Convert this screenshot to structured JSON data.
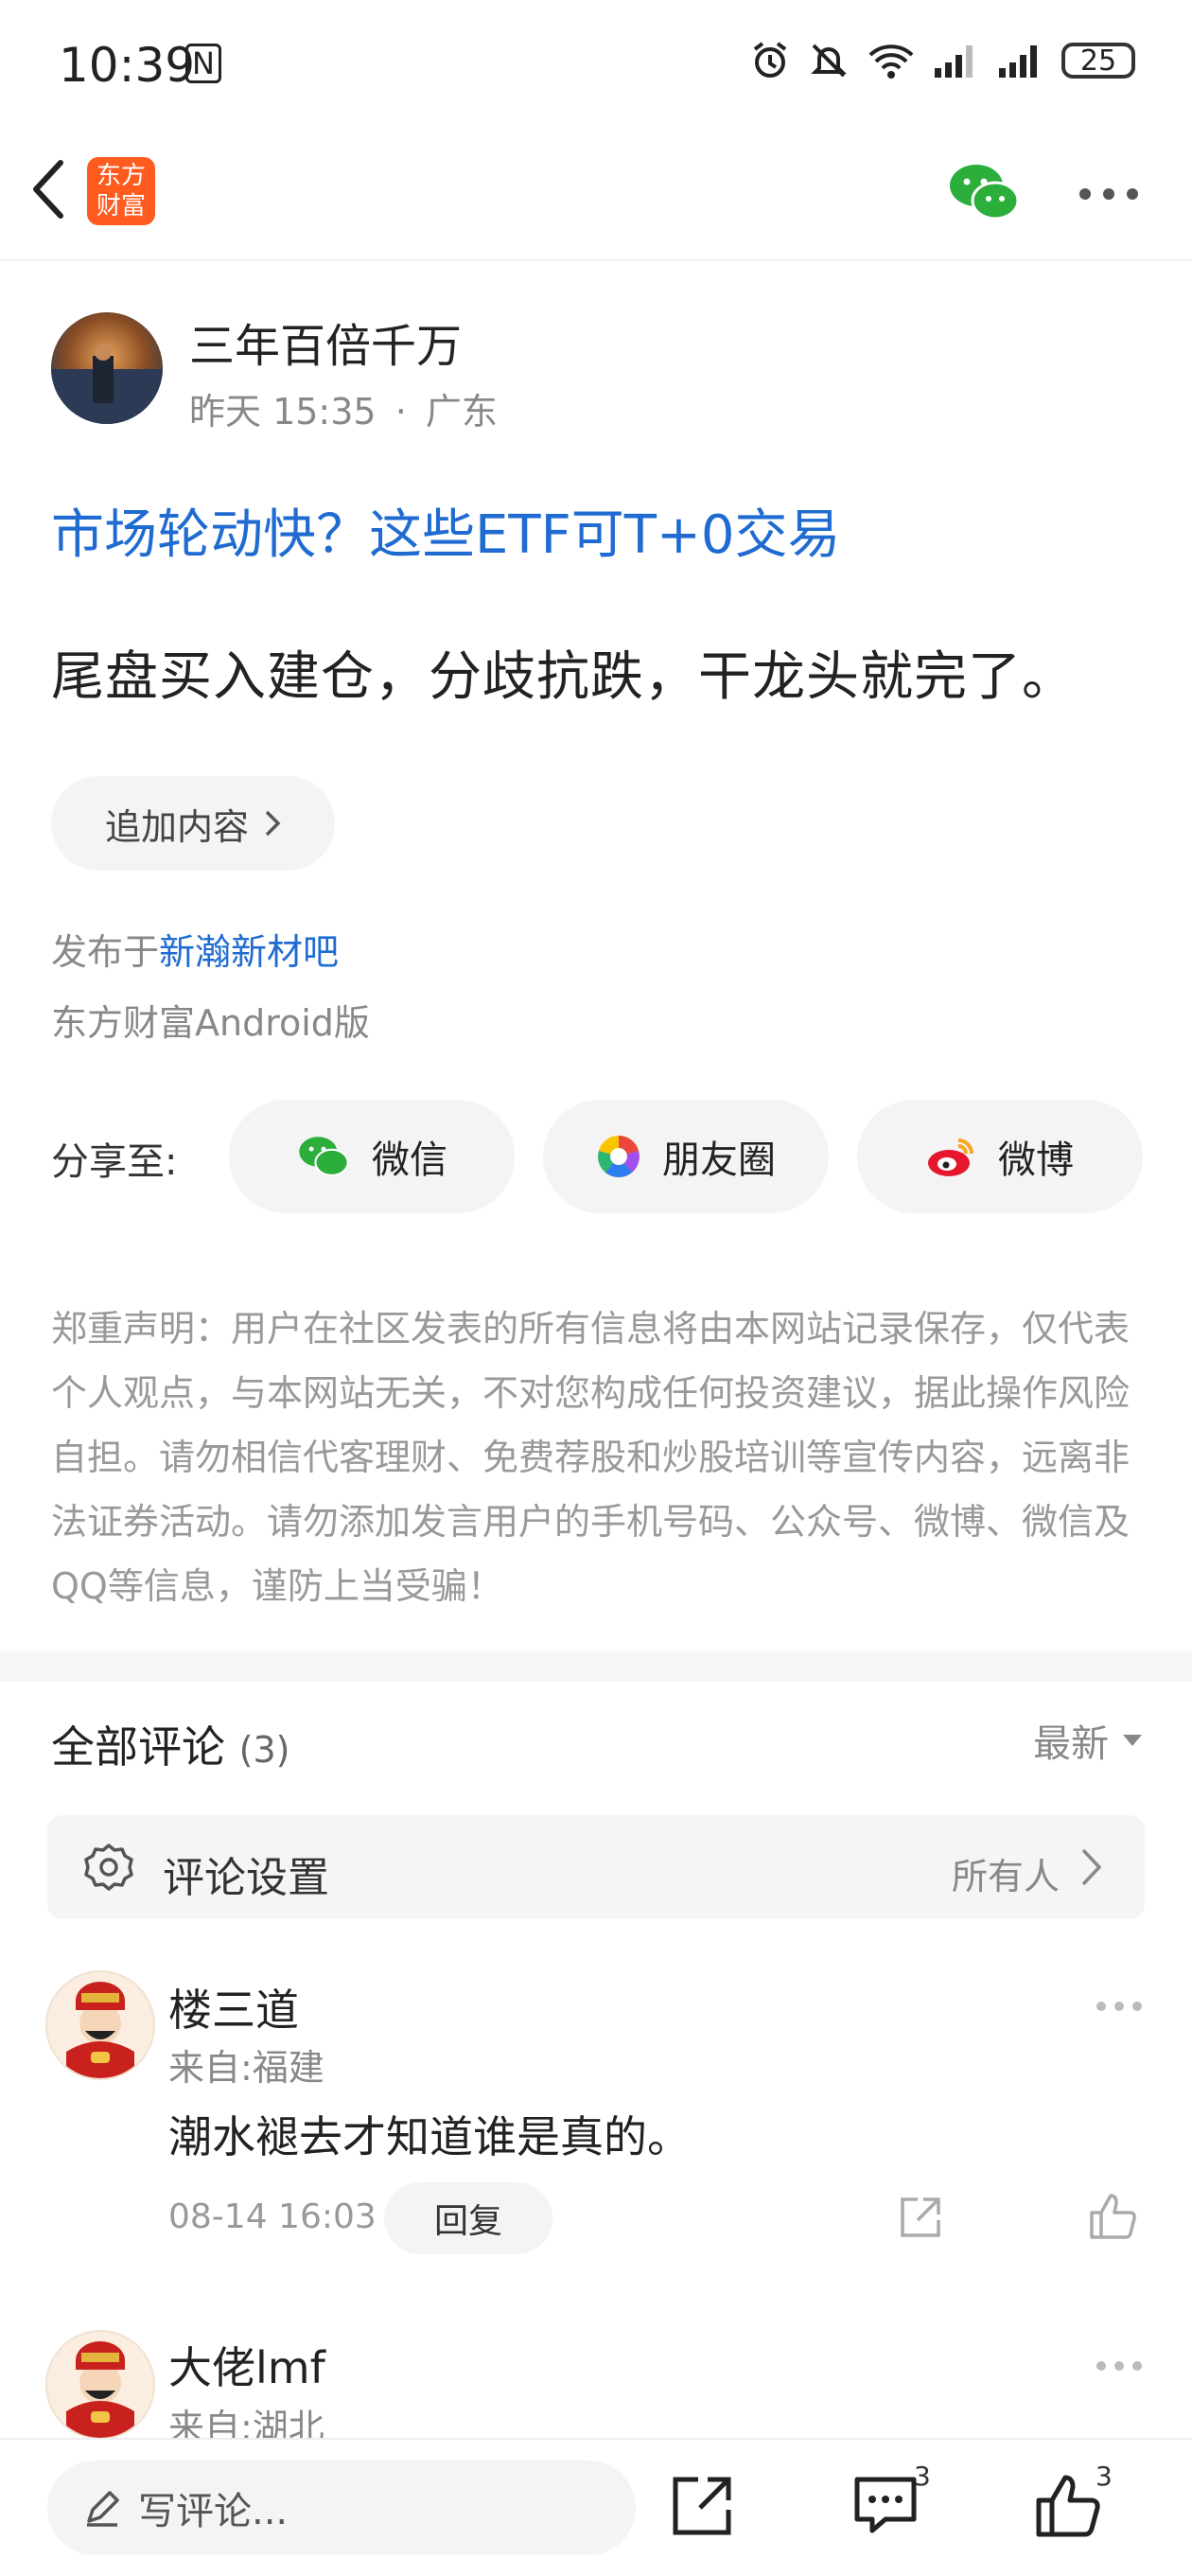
{
  "status_bar": {
    "time": "10:39",
    "nfc": "N",
    "battery": "25"
  },
  "nav": {
    "logo_line1": "东方",
    "logo_line2": "财富"
  },
  "author": {
    "name": "三年百倍千万",
    "time": "昨天 15:35",
    "location": "广东",
    "meta_sep": "·"
  },
  "post": {
    "link_title": "市场轮动快？这些ETF可T+0交易",
    "body": "尾盘买入建仓，分歧抗跌，干龙头就完了。",
    "add_content": "追加内容",
    "published_prefix": "发布于",
    "bar_name": "新瀚新材吧",
    "client": "东方财富Android版"
  },
  "share": {
    "label": "分享至:",
    "wechat": "微信",
    "moments": "朋友圈",
    "weibo": "微博"
  },
  "disclaimer": "郑重声明：用户在社区发表的所有信息将由本网站记录保存，仅代表个人观点，与本网站无关，不对您构成任何投资建议，据此操作风险自担。请勿相信代客理财、免费荐股和炒股培训等宣传内容，远离非法证券活动。请勿添加发言用户的手机号码、公众号、微博、微信及QQ等信息，谨防上当受骗！",
  "comments": {
    "title": "全部评论",
    "count": "(3)",
    "sort": "最新",
    "settings_label": "评论设置",
    "settings_value": "所有人",
    "items": [
      {
        "name": "楼三道",
        "location": "来自:福建",
        "text": "潮水褪去才知道谁是真的。",
        "time": "08-14 16:03",
        "reply": "回复"
      },
      {
        "name": "大佬lmf",
        "location": "来自:湖北"
      }
    ]
  },
  "bottom_bar": {
    "write_placeholder": "写评论...",
    "comment_count": "3",
    "like_count": "3"
  },
  "colors": {
    "accent_blue": "#1f6bd1",
    "logo_orange": "#ff5b1f",
    "wechat_green": "#2bae3a",
    "weibo_red": "#e6162d"
  }
}
